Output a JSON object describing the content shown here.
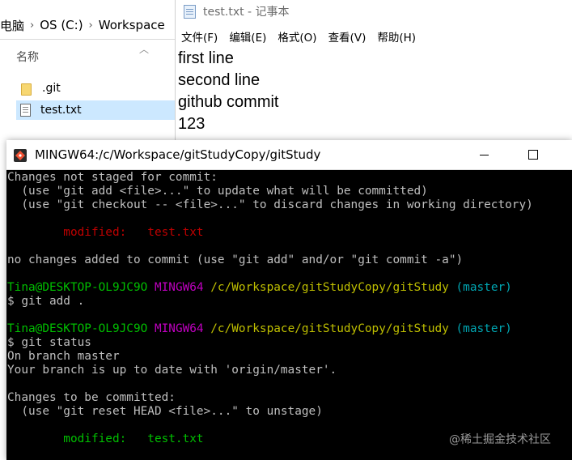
{
  "explorer": {
    "breadcrumb": [
      "电脑",
      "OS (C:)",
      "Workspace"
    ],
    "breadcrumb_sep": "›",
    "column_header": "名称",
    "files": [
      {
        "name": ".git",
        "icon": "folder-icon",
        "selected": false
      },
      {
        "name": "test.txt",
        "icon": "text-file-icon",
        "selected": true
      }
    ]
  },
  "notepad": {
    "title": "test.txt - 记事本",
    "menu": [
      "文件(F)",
      "编辑(E)",
      "格式(O)",
      "查看(V)",
      "帮助(H)"
    ],
    "lines": [
      "first line",
      "second line",
      "github commit",
      "123"
    ]
  },
  "bash": {
    "title": "MINGW64:/c/Workspace/gitStudyCopy/gitStudy",
    "lines": [
      {
        "segments": [
          {
            "text": "Changes not staged for commit:",
            "color": "default"
          }
        ]
      },
      {
        "segments": [
          {
            "text": "  (use \"git add <file>...\" to update what will be committed)",
            "color": "default"
          }
        ]
      },
      {
        "segments": [
          {
            "text": "  (use \"git checkout -- <file>...\" to discard changes in working directory)",
            "color": "default"
          }
        ]
      },
      {
        "segments": [
          {
            "text": "",
            "color": "default"
          }
        ]
      },
      {
        "segments": [
          {
            "text": "        modified:   test.txt",
            "color": "red"
          }
        ]
      },
      {
        "segments": [
          {
            "text": "",
            "color": "default"
          }
        ]
      },
      {
        "segments": [
          {
            "text": "no changes added to commit (use \"git add\" and/or \"git commit -a\")",
            "color": "default"
          }
        ]
      },
      {
        "segments": [
          {
            "text": "",
            "color": "default"
          }
        ]
      },
      {
        "segments": [
          {
            "text": "Tina@DESKTOP-OL9JC9O ",
            "color": "green"
          },
          {
            "text": "MINGW64 ",
            "color": "magenta"
          },
          {
            "text": "/c/Workspace/gitStudyCopy/gitStudy ",
            "color": "yellow"
          },
          {
            "text": "(master)",
            "color": "cyan"
          }
        ]
      },
      {
        "segments": [
          {
            "text": "$ git add .",
            "color": "default"
          }
        ]
      },
      {
        "segments": [
          {
            "text": "",
            "color": "default"
          }
        ]
      },
      {
        "segments": [
          {
            "text": "Tina@DESKTOP-OL9JC9O ",
            "color": "green"
          },
          {
            "text": "MINGW64 ",
            "color": "magenta"
          },
          {
            "text": "/c/Workspace/gitStudyCopy/gitStudy ",
            "color": "yellow"
          },
          {
            "text": "(master)",
            "color": "cyan"
          }
        ]
      },
      {
        "segments": [
          {
            "text": "$ git status",
            "color": "default"
          }
        ]
      },
      {
        "segments": [
          {
            "text": "On branch master",
            "color": "default"
          }
        ]
      },
      {
        "segments": [
          {
            "text": "Your branch is up to date with 'origin/master'.",
            "color": "default"
          }
        ]
      },
      {
        "segments": [
          {
            "text": "",
            "color": "default"
          }
        ]
      },
      {
        "segments": [
          {
            "text": "Changes to be committed:",
            "color": "default"
          }
        ]
      },
      {
        "segments": [
          {
            "text": "  (use \"git reset HEAD <file>...\" to unstage)",
            "color": "default"
          }
        ]
      },
      {
        "segments": [
          {
            "text": "",
            "color": "default"
          }
        ]
      },
      {
        "segments": [
          {
            "text": "        modified:   test.txt",
            "color": "green"
          }
        ]
      }
    ]
  },
  "watermark": "@稀土掘金技术社区",
  "colors": {
    "terminal_bg": "#000000",
    "terminal_fg": "#bfbfbf",
    "red": "#bf0000",
    "green": "#00bf00",
    "magenta": "#bf00bf",
    "yellow": "#bfbf00",
    "cyan": "#00a6b2",
    "selection": "#cce8ff"
  }
}
